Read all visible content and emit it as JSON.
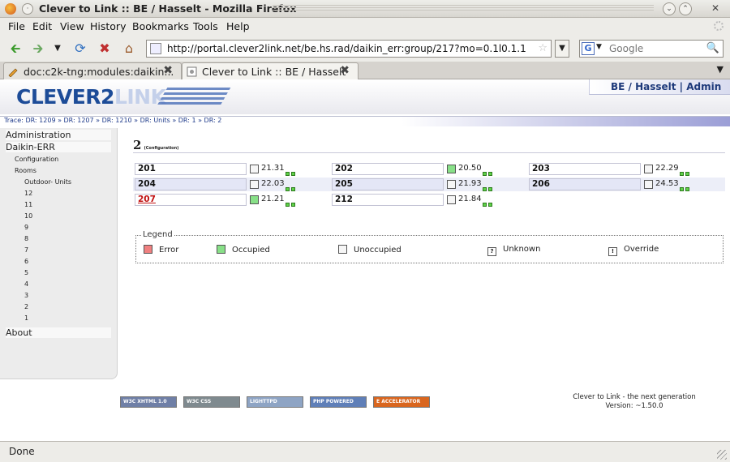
{
  "window": {
    "title": "Clever to Link :: BE / Hasselt - Mozilla Firefox"
  },
  "menu": [
    "File",
    "Edit",
    "View",
    "History",
    "Bookmarks",
    "Tools",
    "Help"
  ],
  "nav": {
    "url": "http://portal.clever2link.net/be.hs.rad/daikin_err:group/217?mo=0.1l0.1.1",
    "search_placeholder": "Google",
    "search_engine_letter": "G"
  },
  "tabs": [
    {
      "label": "doc:c2k-tng:modules:daikin...",
      "active": false
    },
    {
      "label": "Clever to Link :: BE / Hasselt",
      "active": true
    }
  ],
  "site": {
    "logo_main": "CLEVER2",
    "logo_tail": "LINK",
    "user_label": "BE / Hasselt | Admin",
    "trace": "Trace: DR: 1209 » DR: 1207 » DR: 1210 » DR: Units » DR: 1 » DR: 2"
  },
  "sidebar": {
    "items": [
      {
        "label": "Administration",
        "level": 1
      },
      {
        "label": "Daikin-ERR",
        "level": 1
      },
      {
        "label": "Configuration",
        "level": 2
      },
      {
        "label": "Rooms",
        "level": 2
      },
      {
        "label": "Outdoor- Units",
        "level": 3
      },
      {
        "label": "12",
        "level": 3
      },
      {
        "label": "11",
        "level": 3
      },
      {
        "label": "10",
        "level": 3
      },
      {
        "label": "9",
        "level": 3
      },
      {
        "label": "8",
        "level": 3
      },
      {
        "label": "7",
        "level": 3
      },
      {
        "label": "6",
        "level": 3
      },
      {
        "label": "5",
        "level": 3
      },
      {
        "label": "4",
        "level": 3
      },
      {
        "label": "3",
        "level": 3
      },
      {
        "label": "2",
        "level": 3
      },
      {
        "label": "1",
        "level": 3
      },
      {
        "label": "About",
        "level": 1
      }
    ]
  },
  "page": {
    "heading": "2",
    "subheading": "(Configuration)"
  },
  "rooms": [
    {
      "name": "201",
      "temp": "21.31",
      "state": "unoccupied",
      "alarm": false
    },
    {
      "name": "202",
      "temp": "20.50",
      "state": "occupied",
      "alarm": false
    },
    {
      "name": "203",
      "temp": "22.29",
      "state": "unoccupied",
      "alarm": false
    },
    {
      "name": "204",
      "temp": "22.03",
      "state": "unoccupied",
      "alarm": false
    },
    {
      "name": "205",
      "temp": "21.93",
      "state": "unoccupied",
      "alarm": false
    },
    {
      "name": "206",
      "temp": "24.53",
      "state": "unoccupied",
      "alarm": false
    },
    {
      "name": "207",
      "temp": "21.21",
      "state": "occupied",
      "alarm": true
    },
    {
      "name": "212",
      "temp": "21.84",
      "state": "unoccupied",
      "alarm": false
    }
  ],
  "legend": {
    "title": "Legend",
    "items": [
      {
        "label": "Error",
        "color": "#f08080",
        "mark": ""
      },
      {
        "label": "Occupied",
        "color": "#88e088",
        "mark": ""
      },
      {
        "label": "Unoccupied",
        "color": "#f6f6f6",
        "mark": ""
      },
      {
        "label": "Unknown",
        "color": "#ffffff",
        "mark": "?"
      },
      {
        "label": "Override",
        "color": "#ffffff",
        "mark": "!"
      }
    ]
  },
  "badges": [
    {
      "text": "W3C XHTML 1.0",
      "color": "#6f7fa6"
    },
    {
      "text": "W3C CSS",
      "color": "#7f8a8f"
    },
    {
      "text": "LIGHTTPD",
      "color": "#8ea4c4"
    },
    {
      "text": "PHP POWERED",
      "color": "#5f7fb8"
    },
    {
      "text": "E ACCELERATOR",
      "color": "#d9661f"
    }
  ],
  "footer": {
    "line1": "Clever to Link - the next generation",
    "line2": "Version: ~1.50.0"
  },
  "status": {
    "text": "Done"
  }
}
